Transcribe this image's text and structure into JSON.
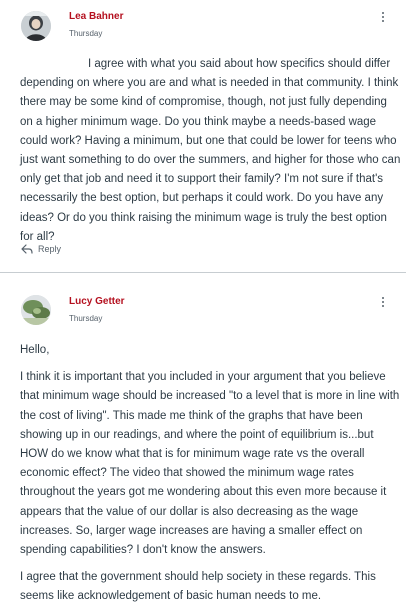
{
  "posts": [
    {
      "author": "Lea Bahner",
      "date": "Thursday",
      "paragraphs": [
        "I agree with what you said about how specifics should differ depending on where you are and what is needed in that community. I think there may be some kind of compromise, though, not just fully depending on a higher minimum wage. Do you think maybe a needs-based wage could work? Having a minimum, but one that could be lower for teens who just want something to do over the summers, and higher for those who can only get that job and need it to support their family? I'm not sure if that's necessarily the best option, but perhaps it could work. Do you have any ideas? Or do you think raising the minimum wage is truly the best option for all?"
      ],
      "reply_label": "Reply",
      "avatar_icon": "user-avatar-photo",
      "options_icon": "kebab-menu-icon"
    },
    {
      "author": "Lucy Getter",
      "date": "Thursday",
      "paragraphs": [
        "Hello,",
        "I think it is important that you included in your argument that you believe that minimum wage should be increased \"to a level that is more in line with the cost of living\". This made me think of the graphs that have been showing up in our readings, and where the point of equilibrium is...but HOW do we know what that is for minimum wage rate vs the overall economic effect? The video that showed the minimum wage rates throughout the years got me wondering about this even more because it appears that the value of our dollar is also decreasing as the wage increases. So, larger wage increases are having a smaller effect on spending capabilities? I don't know the answers.",
        "I agree that the government should help society in these regards. This seems like acknowledgement of basic human needs to me."
      ],
      "avatar_icon": "user-avatar-photo",
      "options_icon": "kebab-menu-icon"
    }
  ],
  "colors": {
    "author": "#b4101f",
    "text": "#2d3b45",
    "muted": "#56616b",
    "divider": "#c7cdd1"
  }
}
